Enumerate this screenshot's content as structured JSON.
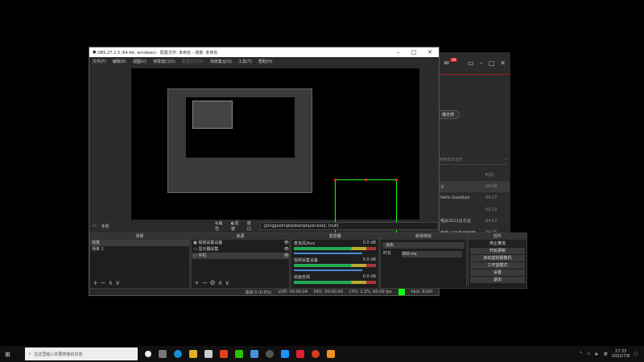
{
  "obs": {
    "title": "OBS 27.2.3 (64-bit, windows) - 配置文件: 未命名 - 场景: 未命名",
    "menu": [
      "文件(F)",
      "编辑(E)",
      "视图(V)",
      "停靠窗口(D)",
      "配置文件(P)",
      "场景集合(S)",
      "工具(T)",
      "帮助(H)"
    ],
    "source_bar": {
      "selected": "手机",
      "properties": "属性",
      "filters": "滤镜",
      "window_label": "窗口",
      "window_value": "[pingguolingtaobairplayer.exe]: (null)"
    },
    "scenes": {
      "title": "场景",
      "items": [
        "场景",
        "场景 2"
      ]
    },
    "sources": {
      "title": "来源",
      "items": [
        "视频采集设备",
        "显示器采集",
        "手机"
      ]
    },
    "mixer": {
      "title": "混音器",
      "channels": [
        {
          "name": "麦克风/Aux",
          "db": "0.0 dB"
        },
        {
          "name": "视频采集设备",
          "db": "0.0 dB"
        },
        {
          "name": "桌面音频",
          "db": "0.0 dB"
        }
      ]
    },
    "transitions": {
      "title": "转场特效",
      "type": "淡出",
      "duration_label": "时长",
      "duration": "300 ms"
    },
    "controls": {
      "title": "控件",
      "buttons": [
        "停止推流",
        "开始录制",
        "启动虚拟摄像机",
        "工作室模式",
        "设置",
        "退出"
      ]
    },
    "status": {
      "dropped": "丢帧 0 (0.0%)",
      "live": "LIVE: 00:00:04",
      "rec": "REC: 00:00:00",
      "cpu": "CPU: 1.3%, 60.00 fps",
      "kbps": "kb/s: 9100"
    }
  },
  "music": {
    "badge": "99",
    "play_all": "播全部",
    "search_placeholder": "搜索歌单音乐",
    "time_header": "时间",
    "songs": [
      {
        "t": "子",
        "d": "04:09"
      },
      {
        "t": "Hello Goodbye",
        "d": "04:27"
      },
      {
        "t": "",
        "d": "03:22"
      },
      {
        "t": "唱会2012台北站",
        "d": "04:52"
      },
      {
        "t": "热唱 (LOVE MOME...",
        "d": "04:35"
      },
      {
        "t": "音频(云版)",
        "d": "03:43"
      },
      {
        "t": "",
        "d": "04:16"
      }
    ]
  },
  "taskbar": {
    "search_placeholder": "在这里输入你要搜索的内容",
    "time": "17:33",
    "date": "2022/7/8",
    "ime": "英"
  }
}
